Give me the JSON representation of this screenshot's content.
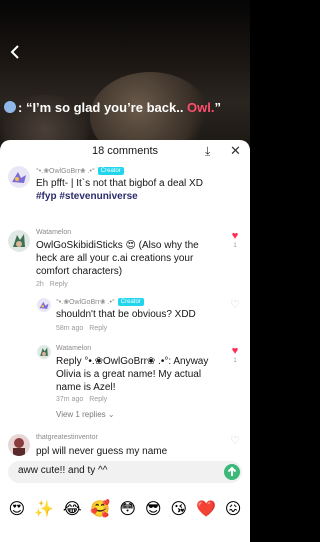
{
  "video": {
    "caption_prefix": ": “I’m so glad you’re back.. ",
    "caption_name": "Owl.",
    "caption_suffix": "”"
  },
  "sheet": {
    "title": "18 comments",
    "close": "✕",
    "download": "⤓"
  },
  "comments": [
    {
      "username": "°•.❀OwlGoBrr❀ .•°",
      "badge": "Creator",
      "text": "Eh pfft- | It`s not that bigbof a deal XD",
      "tags": "#fyp #stevenuniverse"
    },
    {
      "username": "Watamelon",
      "text": "OwlGoSkibidiSticks 😍 (Also why the heck are all your c.ai creations your comfort characters)",
      "time": "2h",
      "reply": "Reply",
      "likes": "1"
    },
    {
      "username": "°•.❀OwlGoBrr❀ .•°",
      "badge": "Creator",
      "text": "shouldn't that be obvious? XDD",
      "time": "58m ago",
      "reply": "Reply"
    },
    {
      "username": "Watamelon",
      "text": "Reply °•.❀OwlGoBrr❀ .•°: Anyway Olivia is a great name! My actual name is Azel!",
      "time": "37m ago",
      "reply": "Reply",
      "likes": "1"
    },
    {
      "username": "thatgreatestinventor",
      "text": "ppl will never guess my name"
    }
  ],
  "view_replies": "View 1 replies ⌄",
  "input": {
    "value": "aww cute!! and ty ^^"
  },
  "emojis": [
    "😍",
    "✨",
    "😂",
    "🥰",
    "😳",
    "😎",
    "😘",
    "❤️",
    "😖"
  ]
}
